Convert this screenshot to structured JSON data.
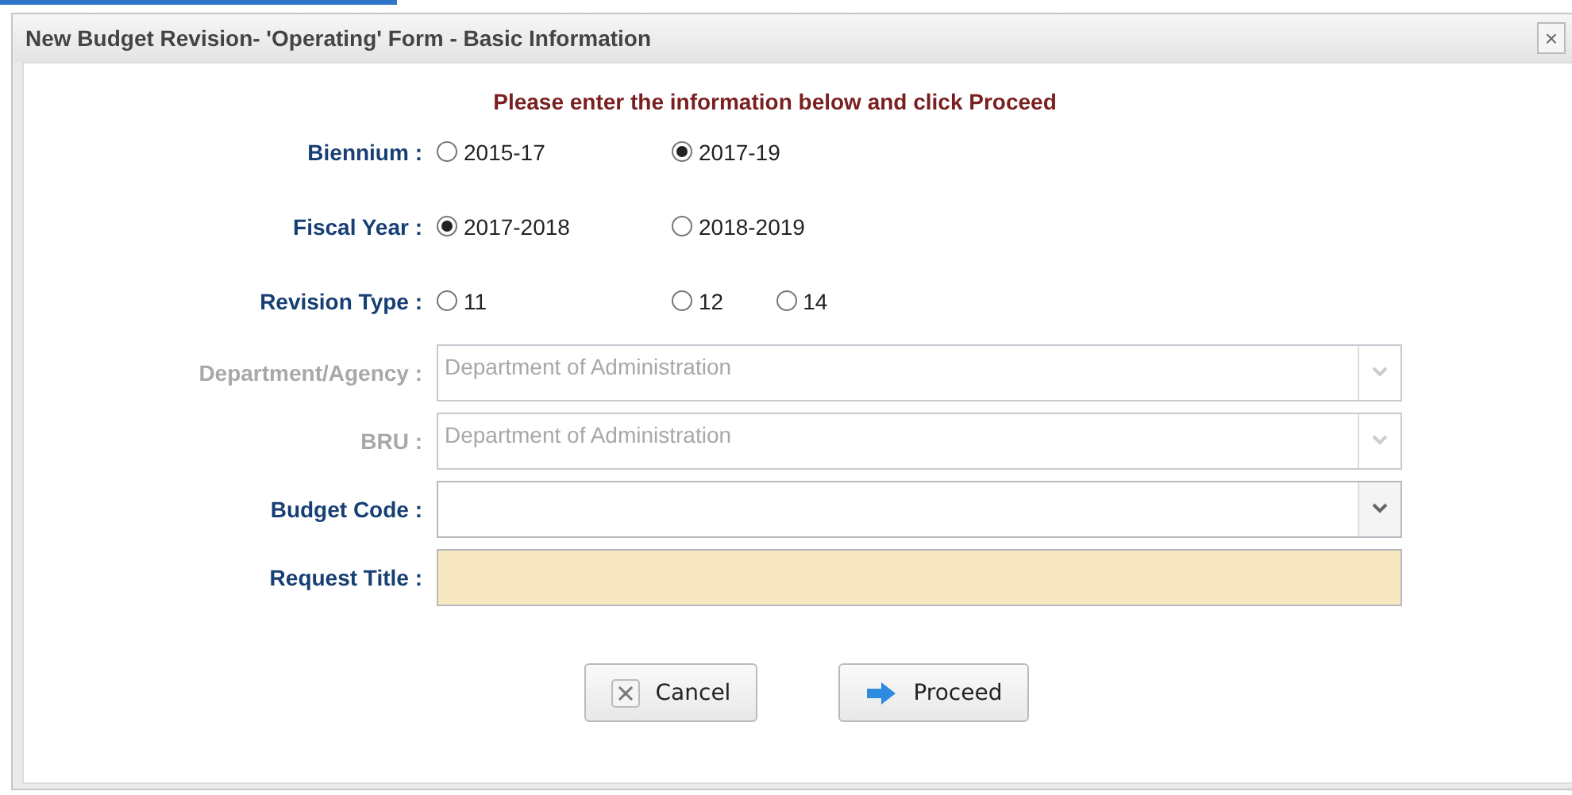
{
  "window": {
    "title": "New Budget Revision- 'Operating' Form - Basic Information",
    "close": "×"
  },
  "instruction": "Please enter the information below and click Proceed",
  "radio_groups": [
    {
      "label": "Biennium :",
      "options": [
        {
          "label": "2015-17",
          "selected": false
        },
        {
          "label": "2017-19",
          "selected": true
        }
      ]
    },
    {
      "label": "Fiscal Year :",
      "options": [
        {
          "label": "2017-2018",
          "selected": true
        },
        {
          "label": "2018-2019",
          "selected": false
        }
      ]
    },
    {
      "label": "Revision Type :",
      "options": [
        {
          "label": "11",
          "selected": false
        },
        {
          "label": "12",
          "selected": false
        },
        {
          "label": "14",
          "selected": false
        }
      ]
    }
  ],
  "fields": [
    {
      "label": "Department/Agency :",
      "kind": "select",
      "disabled": true,
      "value": "Department of Administration"
    },
    {
      "label": "BRU :",
      "kind": "select",
      "disabled": true,
      "value": "Department of Administration"
    },
    {
      "label": "Budget Code :",
      "kind": "select",
      "disabled": false
    },
    {
      "label": "Request Title :",
      "kind": "text",
      "disabled": false,
      "required": true
    }
  ],
  "buttons": [
    {
      "label": "Cancel",
      "kind": "cancel"
    },
    {
      "label": "Proceed",
      "kind": "proceed"
    }
  ]
}
